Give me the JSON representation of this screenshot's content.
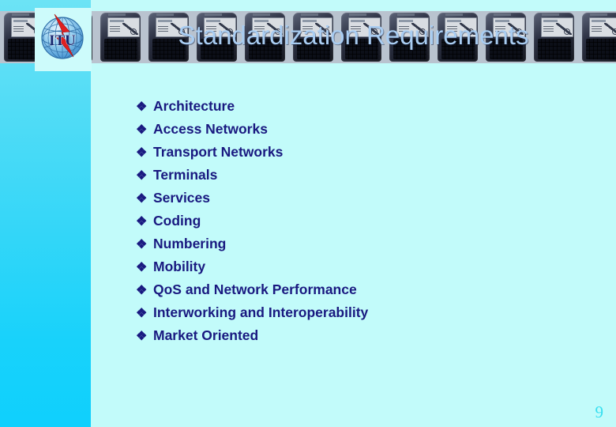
{
  "slide": {
    "title": "Standardization Requirements",
    "page_number": "9",
    "colors": {
      "sidebar_top": "#6ce3f5",
      "sidebar_bottom": "#0fd0fd",
      "body_background": "#c2fbfa",
      "title_text": "#a9cdf2",
      "bullet_text": "#191980",
      "page_number": "#36dff0"
    }
  },
  "logo": {
    "name": "ITU",
    "text": "ITU"
  },
  "bullets": {
    "marker": "❖",
    "items": [
      {
        "label": "Architecture"
      },
      {
        "label": "Access Networks"
      },
      {
        "label": "Transport Networks"
      },
      {
        "label": "Terminals"
      },
      {
        "label": "Services"
      },
      {
        "label": "Coding"
      },
      {
        "label": "Numbering"
      },
      {
        "label": "Mobility"
      },
      {
        "label": "QoS and Network Performance"
      },
      {
        "label": "Interworking and Interoperability"
      },
      {
        "label": "Market Oriented"
      }
    ]
  }
}
